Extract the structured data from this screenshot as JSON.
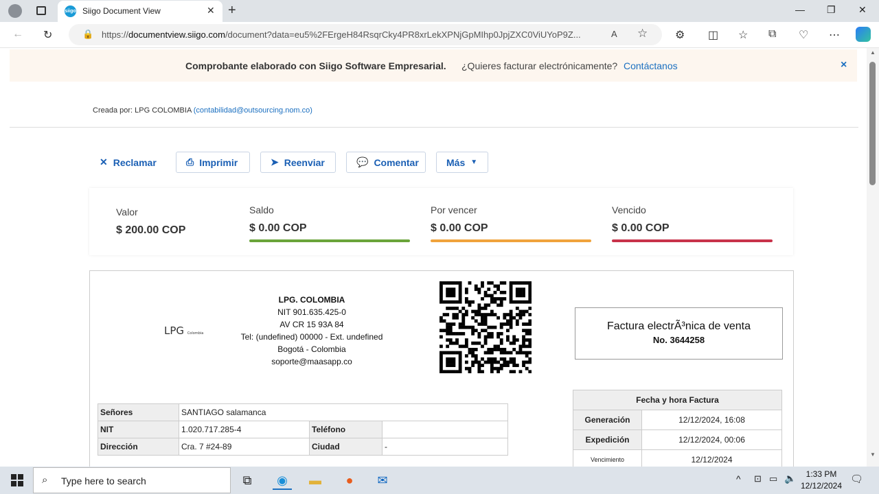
{
  "browser": {
    "tab_title": "Siigo Document View",
    "url_prefix": "https://",
    "url_host": "documentview.siigo.com",
    "url_rest": "/document?data=eu5%2FErgeH84RsqrCky4PR8xrLekXPNjGpMIhp0JpjZXC0ViUYoP9Z..."
  },
  "banner": {
    "bold_text": "Comprobante elaborado con Siigo Software Empresarial.",
    "question": "¿Quieres facturar electrónicamente?",
    "link": "Contáctanos",
    "close": "×"
  },
  "creada": {
    "label": "Creada por: LPG COLOMBIA",
    "email": "(contabilidad@outsourcing.nom.co)"
  },
  "actions": {
    "reclamar": "Reclamar",
    "imprimir": "Imprimir",
    "reenviar": "Reenviar",
    "comentar": "Comentar",
    "mas": "Más"
  },
  "summary": {
    "valor_label": "Valor",
    "valor": "$ 200.00 COP",
    "saldo_label": "Saldo",
    "saldo": "$ 0.00 COP",
    "por_vencer_label": "Por vencer",
    "por_vencer": "$ 0.00 COP",
    "vencido_label": "Vencido",
    "vencido": "$ 0.00 COP",
    "colors": {
      "saldo": "#6aa43a",
      "por_vencer": "#f0a33c",
      "vencido": "#c8324a"
    }
  },
  "invoice": {
    "logo": "LPG",
    "logo_sub": "Colombia",
    "company_name": "LPG. COLOMBIA",
    "nit": "NIT 901.635.425-0",
    "address": "AV CR 15 93A 84",
    "tel": "Tel: (undefined) 00000 - Ext. undefined",
    "city": "Bogotá - Colombia",
    "email": "soporte@maasapp.co",
    "doc_type": "Factura electrÃ³nica de venta",
    "doc_number": "No. 3644258",
    "client": {
      "senores_label": "Señores",
      "senores": "SANTIAGO salamanca",
      "nit_label": "NIT",
      "nit": "1.020.717.285-4",
      "telefono_label": "Teléfono",
      "telefono": "",
      "direccion_label": "Dirección",
      "direccion": "Cra. 7 #24-89",
      "ciudad_label": "Ciudad",
      "ciudad": "-"
    },
    "fecha": {
      "header": "Fecha y hora Factura",
      "generacion_label": "Generación",
      "generacion": "12/12/2024, 16:08",
      "expedicion_label": "Expedición",
      "expedicion": "12/12/2024, 00:06",
      "vencimiento_label": "Vencimiento",
      "vencimiento": "12/12/2024"
    }
  },
  "taskbar": {
    "search_placeholder": "Type here to search",
    "time": "1:33 PM",
    "date": "12/12/2024"
  }
}
